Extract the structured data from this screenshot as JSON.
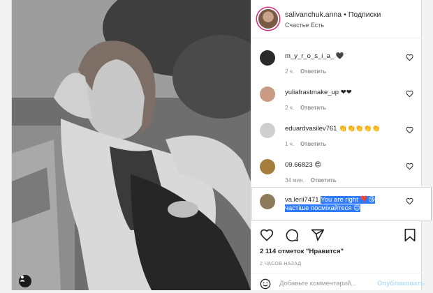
{
  "post": {
    "username": "salivanchuk.anna",
    "separator": "•",
    "follow_label": "Подписки",
    "location": "Счастье Есть",
    "comments": [
      {
        "user": "m_y_r_o_s_i_a_",
        "text": "🖤",
        "age": "2 ч.",
        "reply": "Ответить",
        "avatar_color": "#2a2a2a"
      },
      {
        "user": "yuliafrastmake_up",
        "text": "❤❤",
        "age": "2 ч.",
        "reply": "Ответить",
        "avatar_color": "#c99a84"
      },
      {
        "user": "eduardvasilev761",
        "text": "👏👏👏👏👏",
        "age": "1 ч.",
        "reply": "Ответить",
        "avatar_color": "#cfcfcf"
      },
      {
        "user": "09.66823",
        "text": "😍",
        "age": "34 мин.",
        "reply": "Ответить",
        "avatar_color": "#a47c3e"
      },
      {
        "user": "va.lerii7471",
        "text_line1": "You are right ❣️😘",
        "text_line2": "частіше посміхайтеся 😊",
        "avatar_color": "#8c7a5a"
      }
    ],
    "likes": "2 114 отметок \"Нравится\"",
    "posted_ago": "2 ЧАСОВ НАЗАД",
    "comment_placeholder": "Добавьте комментарий...",
    "publish_label": "Опубликовать"
  },
  "icons": {
    "like": "heart-icon",
    "comment": "comment-icon",
    "share": "share-icon",
    "save": "bookmark-icon",
    "emoji": "smile-icon",
    "tag": "user-tag-icon"
  },
  "colors": {
    "selection": "#2f7bff",
    "publish_disabled": "#b2dffc",
    "story_ring": "#d62976"
  }
}
